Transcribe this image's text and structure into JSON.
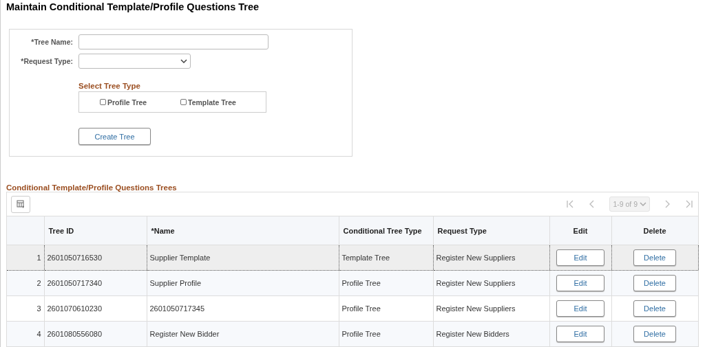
{
  "page_title": "Maintain Conditional Template/Profile Questions Tree",
  "form": {
    "tree_name": {
      "label": "*Tree Name:"
    },
    "request_type": {
      "label": "*Request Type:"
    },
    "tree_type": {
      "heading": "Select Tree Type",
      "options": [
        {
          "label": "Profile Tree",
          "checked": false
        },
        {
          "label": "Template Tree",
          "checked": false
        }
      ]
    },
    "create_button": "Create Tree"
  },
  "grid": {
    "title": "Conditional Template/Profile Questions Trees",
    "pager": {
      "range": "1-9 of 9"
    },
    "columns": [
      "",
      "Tree ID",
      "*Name",
      "Conditional Tree Type",
      "Request Type",
      "Edit",
      "Delete"
    ],
    "rows": [
      {
        "num": "1",
        "tree_id": "2601050716530",
        "name": "Supplier Template",
        "tree_type": "Template Tree",
        "request_type": "Register New Suppliers",
        "edit": "Edit",
        "delete": "Delete",
        "selected": true
      },
      {
        "num": "2",
        "tree_id": "2601050717340",
        "name": "Supplier Profile",
        "tree_type": "Profile Tree",
        "request_type": "Register New Suppliers",
        "edit": "Edit",
        "delete": "Delete",
        "selected": false
      },
      {
        "num": "3",
        "tree_id": "2601070610230",
        "name": "2601050717345",
        "tree_type": "Profile Tree",
        "request_type": "Register New Suppliers",
        "edit": "Edit",
        "delete": "Delete",
        "selected": false
      },
      {
        "num": "4",
        "tree_id": "2601080556080",
        "name": "Register New Bidder",
        "tree_type": "Profile Tree",
        "request_type": "Register New Bidders",
        "edit": "Edit",
        "delete": "Delete",
        "selected": false
      }
    ]
  }
}
